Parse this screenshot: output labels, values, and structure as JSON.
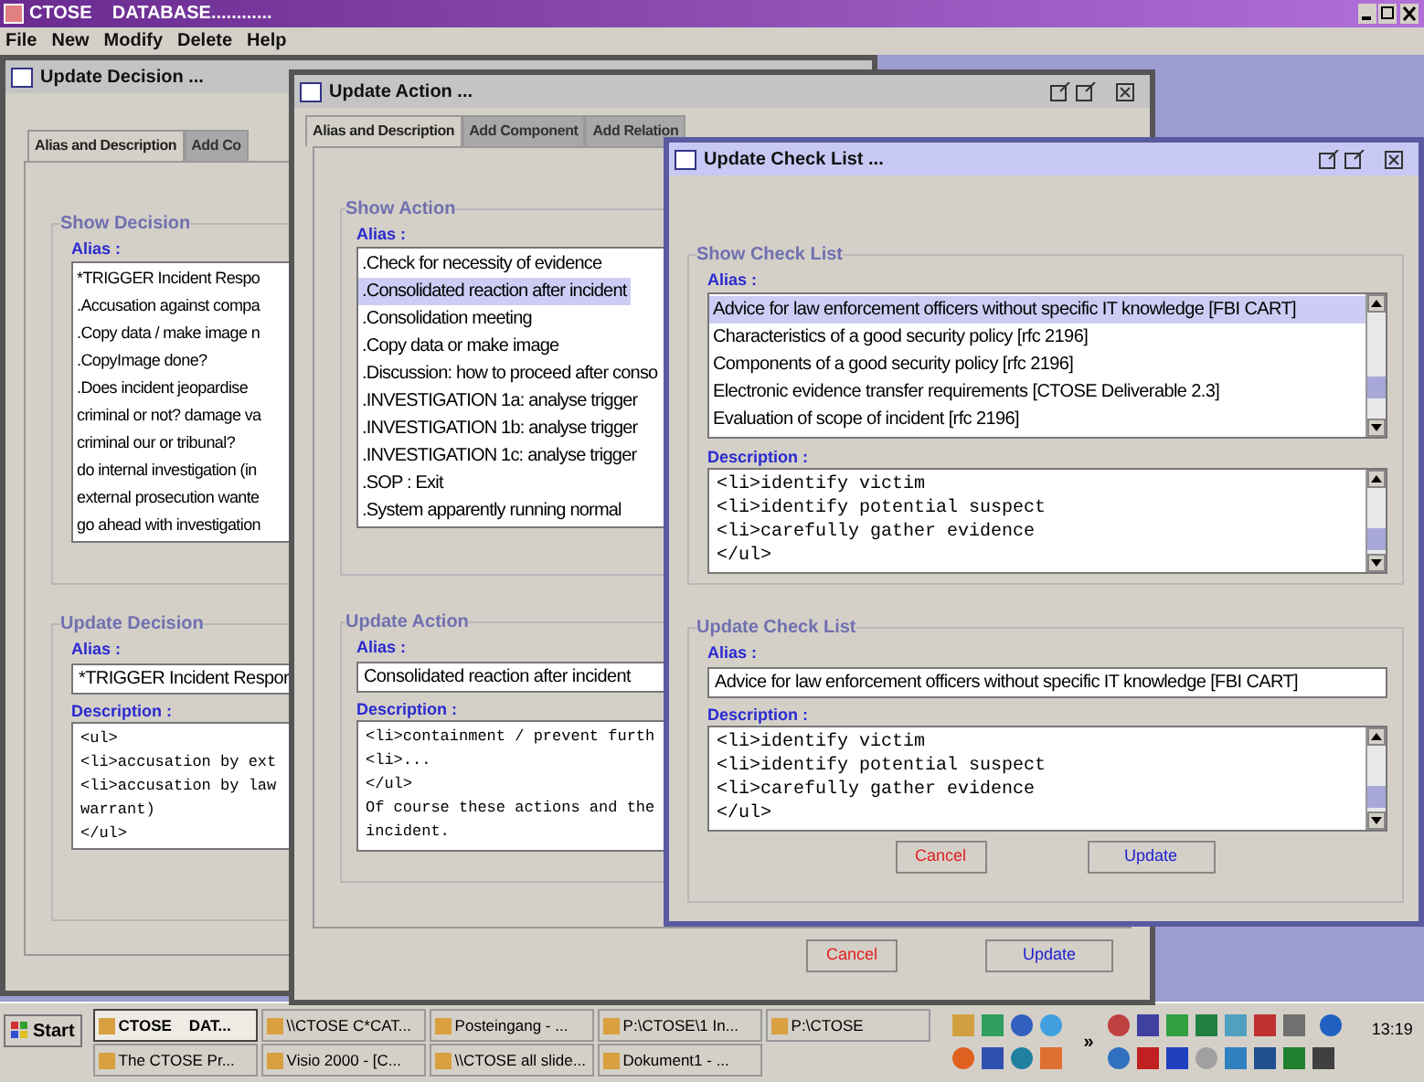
{
  "app": {
    "title": "CTOSE    DATABASE............",
    "menu": [
      "File",
      "New",
      "Modify",
      "Delete",
      "Help"
    ]
  },
  "windows": [
    {
      "title": "Update Decision ...",
      "active": false,
      "tabs": [
        {
          "label": "Alias and Description",
          "selected": true
        },
        {
          "label": "Add Co",
          "selected": false
        }
      ],
      "show": {
        "legend": "Show Decision",
        "alias_label": "Alias :",
        "items": [
          {
            "text": "*TRIGGER Incident Respo",
            "selected": false
          },
          {
            "text": ".Accusation against compa",
            "selected": false
          },
          {
            "text": ".Copy data / make image n",
            "selected": false
          },
          {
            "text": ".CopyImage done?",
            "selected": false
          },
          {
            "text": ".Does incident jeopardise",
            "selected": false
          },
          {
            "text": "criminal or not? damage va",
            "selected": false
          },
          {
            "text": "criminal our or tribunal?",
            "selected": false
          },
          {
            "text": "do internal investigation (in",
            "selected": false
          },
          {
            "text": "external prosecution wante",
            "selected": false
          },
          {
            "text": "go ahead with investigation",
            "selected": false
          }
        ]
      },
      "update": {
        "legend": "Update Decision",
        "alias_label": "Alias :",
        "alias": "*TRIGGER Incident Respor",
        "description_label": "Description :",
        "description": [
          "<ul>",
          "<li>accusation by ext",
          "<li>accusation by law",
          "warrant)",
          "</ul>"
        ]
      }
    },
    {
      "title": "Update Action ...",
      "active": false,
      "tabs": [
        {
          "label": "Alias and Description",
          "selected": true
        },
        {
          "label": "Add Component",
          "selected": false
        },
        {
          "label": "Add Relation",
          "selected": false
        }
      ],
      "show": {
        "legend": "Show Action",
        "alias_label": "Alias :",
        "items": [
          {
            "text": ".Check for necessity of evidence",
            "selected": false
          },
          {
            "text": ".Consolidated reaction after incident",
            "selected": true
          },
          {
            "text": ".Consolidation meeting",
            "selected": false
          },
          {
            "text": ".Copy data or make image",
            "selected": false
          },
          {
            "text": ".Discussion: how to proceed after conso",
            "selected": false
          },
          {
            "text": ".INVESTIGATION 1a: analyse trigger",
            "selected": false
          },
          {
            "text": ".INVESTIGATION 1b: analyse trigger",
            "selected": false
          },
          {
            "text": ".INVESTIGATION 1c: analyse trigger",
            "selected": false
          },
          {
            "text": ".SOP : Exit",
            "selected": false
          },
          {
            "text": ".System apparently running normal",
            "selected": false
          }
        ]
      },
      "update": {
        "legend": "Update Action",
        "alias_label": "Alias :",
        "alias": "Consolidated reaction after incident",
        "description_label": "Description :",
        "description": [
          "<li>containment / prevent furth",
          "<li>...",
          "</ul>",
          "Of course these actions and the",
          "incident."
        ]
      },
      "buttons": [
        {
          "label": "Cancel",
          "kind": "cancel"
        },
        {
          "label": "Update",
          "kind": "update"
        }
      ]
    },
    {
      "title": "Update Check List ...",
      "active": true,
      "show": {
        "legend": "Show Check List",
        "alias_label": "Alias :",
        "items": [
          {
            "text": "Advice for law enforcement officers without specific IT knowledge [FBI CART]",
            "selected": true
          },
          {
            "text": "Characteristics of a good security policy [rfc 2196]",
            "selected": false
          },
          {
            "text": "Components of a good security policy [rfc 2196]",
            "selected": false
          },
          {
            "text": "Electronic evidence transfer requirements [CTOSE Deliverable 2.3]",
            "selected": false
          },
          {
            "text": "Evaluation of scope of incident [rfc 2196]",
            "selected": false
          }
        ],
        "description_label": "Description :",
        "description": [
          "<li>identify victim",
          "<li>identify potential suspect",
          "<li>carefully gather evidence",
          "</ul>"
        ]
      },
      "update": {
        "legend": "Update Check List",
        "alias_label": "Alias :",
        "alias": "Advice for law enforcement officers without specific IT knowledge [FBI CART]",
        "description_label": "Description :",
        "description": [
          "<li>identify victim",
          "<li>identify potential suspect",
          "<li>carefully gather evidence",
          "</ul>"
        ]
      },
      "buttons": [
        {
          "label": "Cancel",
          "kind": "cancel"
        },
        {
          "label": "Update",
          "kind": "update"
        }
      ]
    }
  ],
  "taskbar": {
    "start": "Start",
    "tasks": [
      {
        "label": "CTOSE    DAT...",
        "selected": true
      },
      {
        "label": "\\\\CTOSE C*CAT...",
        "selected": false
      },
      {
        "label": "Posteingang - ...",
        "selected": false
      },
      {
        "label": "P:\\CTOSE\\1 In...",
        "selected": false
      },
      {
        "label": "P:\\CTOSE",
        "selected": false
      },
      {
        "label": "The CTOSE Pr...",
        "selected": false
      },
      {
        "label": "Visio 2000 - [C...",
        "selected": false
      },
      {
        "label": "\\\\CTOSE all slide...",
        "selected": false
      },
      {
        "label": "Dokument1 - ...",
        "selected": false
      }
    ],
    "more": "»",
    "clock": "13:19"
  }
}
